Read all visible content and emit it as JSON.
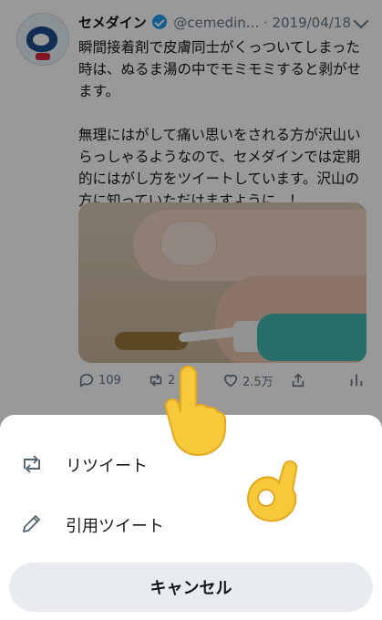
{
  "tweet": {
    "display_name": "セメダイン",
    "handle": "@cemedin...",
    "separator": "·",
    "date": "2019/04/18",
    "text": "瞬間接着剤で皮膚同士がくっついてしまった時は、ぬるま湯の中でモミモミすると剥がせます。\n\n無理にはがして痛い思いをされる方が沢山いらっしゃるようなので、セメダインでは定期的にはがし方をツイートしています。沢山の方に知っていただけますように...！",
    "replies": "109",
    "retweets": "2",
    "likes": "2.5万"
  },
  "sheet": {
    "retweet_label": "リツイート",
    "quote_label": "引用ツイート",
    "cancel_label": "キャンセル"
  },
  "icons": [
    "verified-badge-icon",
    "chevron-down-icon",
    "reply-icon",
    "retweet-icon",
    "like-icon",
    "share-icon",
    "stats-icon",
    "pencil-icon",
    "pointing-hand-icon",
    "ok-hand-icon"
  ],
  "colors": {
    "accent_blue": "#1d9bf0",
    "muted": "#657786",
    "cancel_bg": "#e8ecef"
  }
}
